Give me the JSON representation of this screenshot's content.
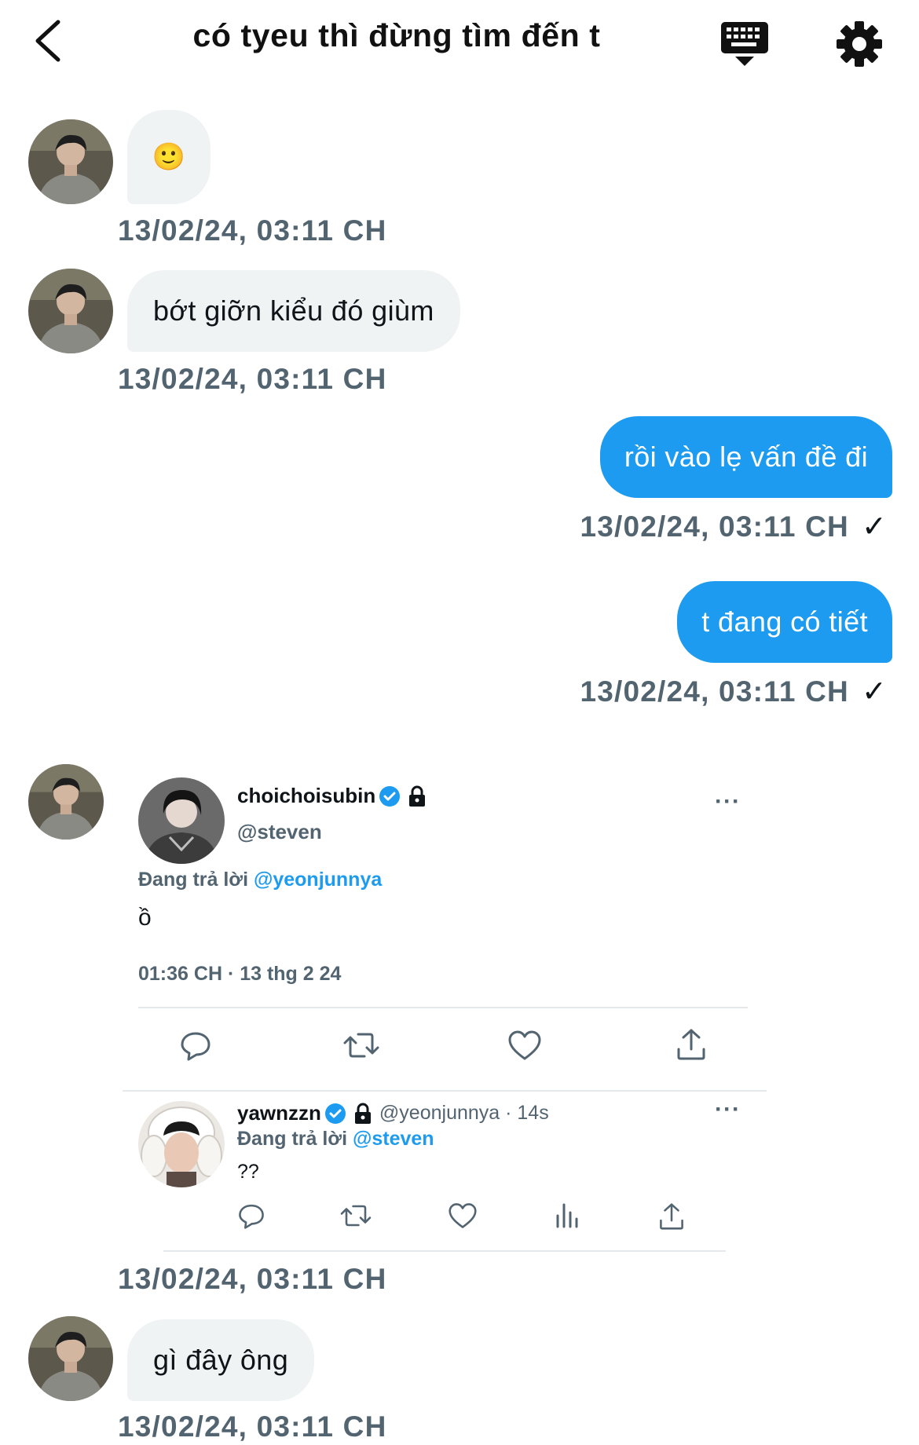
{
  "header": {
    "back_icon": "chevron-left-icon",
    "title": "có tyeu thì đừng tìm đến t",
    "keyboard_icon": "keyboard-icon",
    "settings_icon": "gear-icon"
  },
  "messages": [
    {
      "from": "them",
      "text": "🙂",
      "time": "13/02/24, 03:11 CH"
    },
    {
      "from": "them",
      "text": "bớt giỡn kiểu đó giùm",
      "time": "13/02/24, 03:11 CH"
    },
    {
      "from": "me",
      "text": "rồi vào lẹ vấn đề đi",
      "time": "13/02/24, 03:11 CH",
      "status": "✓"
    },
    {
      "from": "me",
      "text": "t đang có tiết",
      "time": "13/02/24, 03:11 CH",
      "status": "✓"
    },
    {
      "from": "them",
      "time": "13/02/24, 03:11 CH"
    },
    {
      "from": "them",
      "text": "gì đây ông",
      "time": "13/02/24, 03:11 CH"
    }
  ],
  "shared_tweet": {
    "author_name": "choichoisubin",
    "author_handle": "@steven",
    "reply_prefix": "Đang trả lời",
    "reply_to": "@yeonjunnya",
    "text": "ồ",
    "timestamp": "01:36 CH · 13 thg 2 24",
    "more": "···",
    "actions": [
      "reply-icon",
      "retweet-icon",
      "like-icon",
      "share-icon"
    ],
    "reply": {
      "author_name": "yawnzzn",
      "author_handle": "@yeonjunnya · 14s",
      "reply_prefix": "Đang trả lời",
      "reply_to": "@steven",
      "text": "??",
      "more": "···",
      "actions": [
        "reply-icon",
        "retweet-icon",
        "like-icon",
        "views-icon",
        "share-icon"
      ]
    }
  },
  "colors": {
    "accent": "#1d9bf0",
    "received_bubble": "#eff3f4",
    "secondary_text": "#536471"
  }
}
